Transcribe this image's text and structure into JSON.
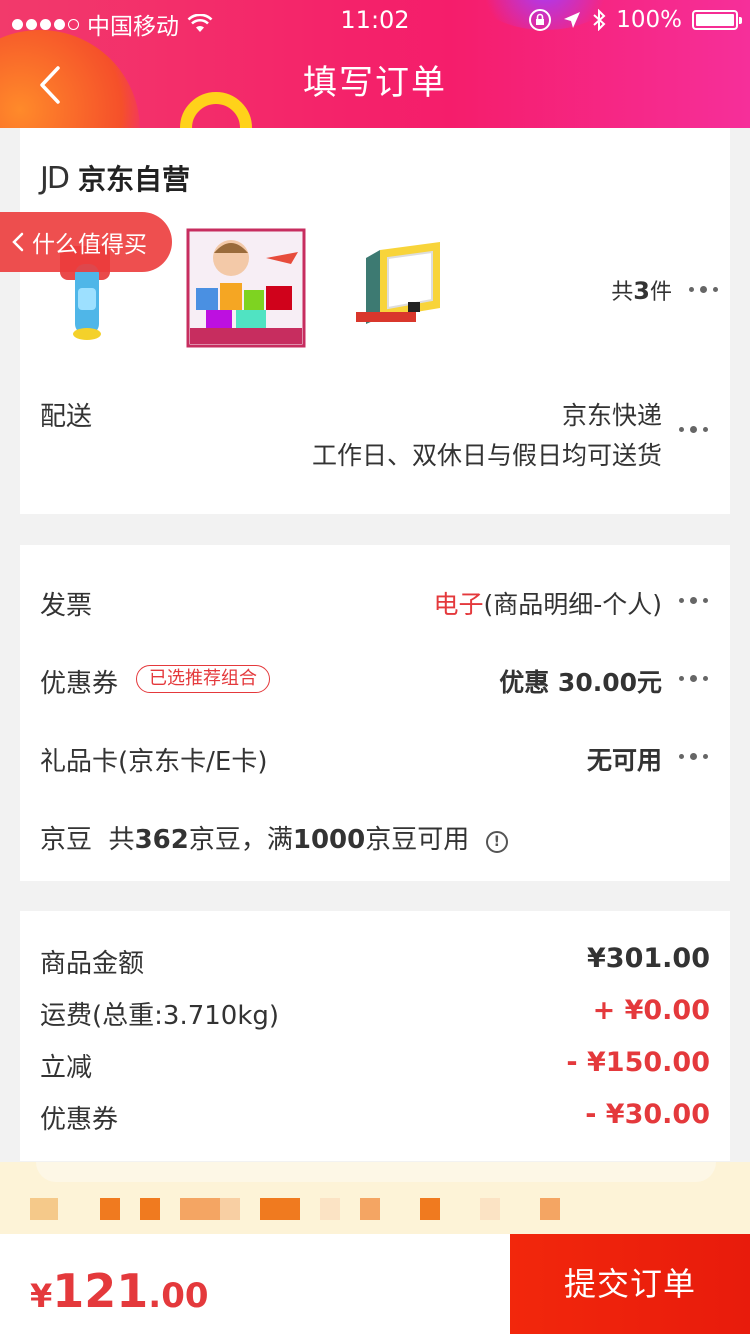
{
  "status_bar": {
    "carrier": "中国移动",
    "time": "11:02",
    "battery": "100%"
  },
  "header": {
    "title": "填写订单",
    "back_icon": "chevron-left-icon"
  },
  "shop": {
    "logo": "JD",
    "name": "京东自营"
  },
  "promo_tag": {
    "label": "什么值得买"
  },
  "goods": {
    "count_prefix": "共",
    "count": "3",
    "count_suffix": "件"
  },
  "delivery": {
    "label": "配送",
    "method": "京东快递",
    "time": "工作日、双休日与假日均可送货"
  },
  "invoice": {
    "label": "发票",
    "type": "电子",
    "detail": "(商品明细-个人)"
  },
  "coupon": {
    "label": "优惠券",
    "badge": "已选推荐组合",
    "value": "优惠 30.00元"
  },
  "gift_card": {
    "label": "礼品卡(京东卡/E卡)",
    "value": "无可用"
  },
  "jingdou": {
    "label": "京豆",
    "t1": "共",
    "count": "362",
    "t2": "京豆，满",
    "threshold": "1000",
    "t3": "京豆可用"
  },
  "amounts": [
    {
      "label": "商品金额",
      "value": "¥301.00",
      "color": "#333333"
    },
    {
      "label": "运费(总重:3.710kg)",
      "value": "+ ¥0.00",
      "color": "#e4393c"
    },
    {
      "label": "立减",
      "value": "- ¥150.00",
      "color": "#e4393c"
    },
    {
      "label": "优惠券",
      "value": "- ¥30.00",
      "color": "#e4393c"
    }
  ],
  "bottom": {
    "currency": "¥",
    "total_int": "121",
    "total_dec": ".00",
    "submit_label": "提交订单"
  },
  "colors": {
    "accent": "#e4393c",
    "header_gradient": [
      "#f23a6b",
      "#f62f9a"
    ]
  }
}
